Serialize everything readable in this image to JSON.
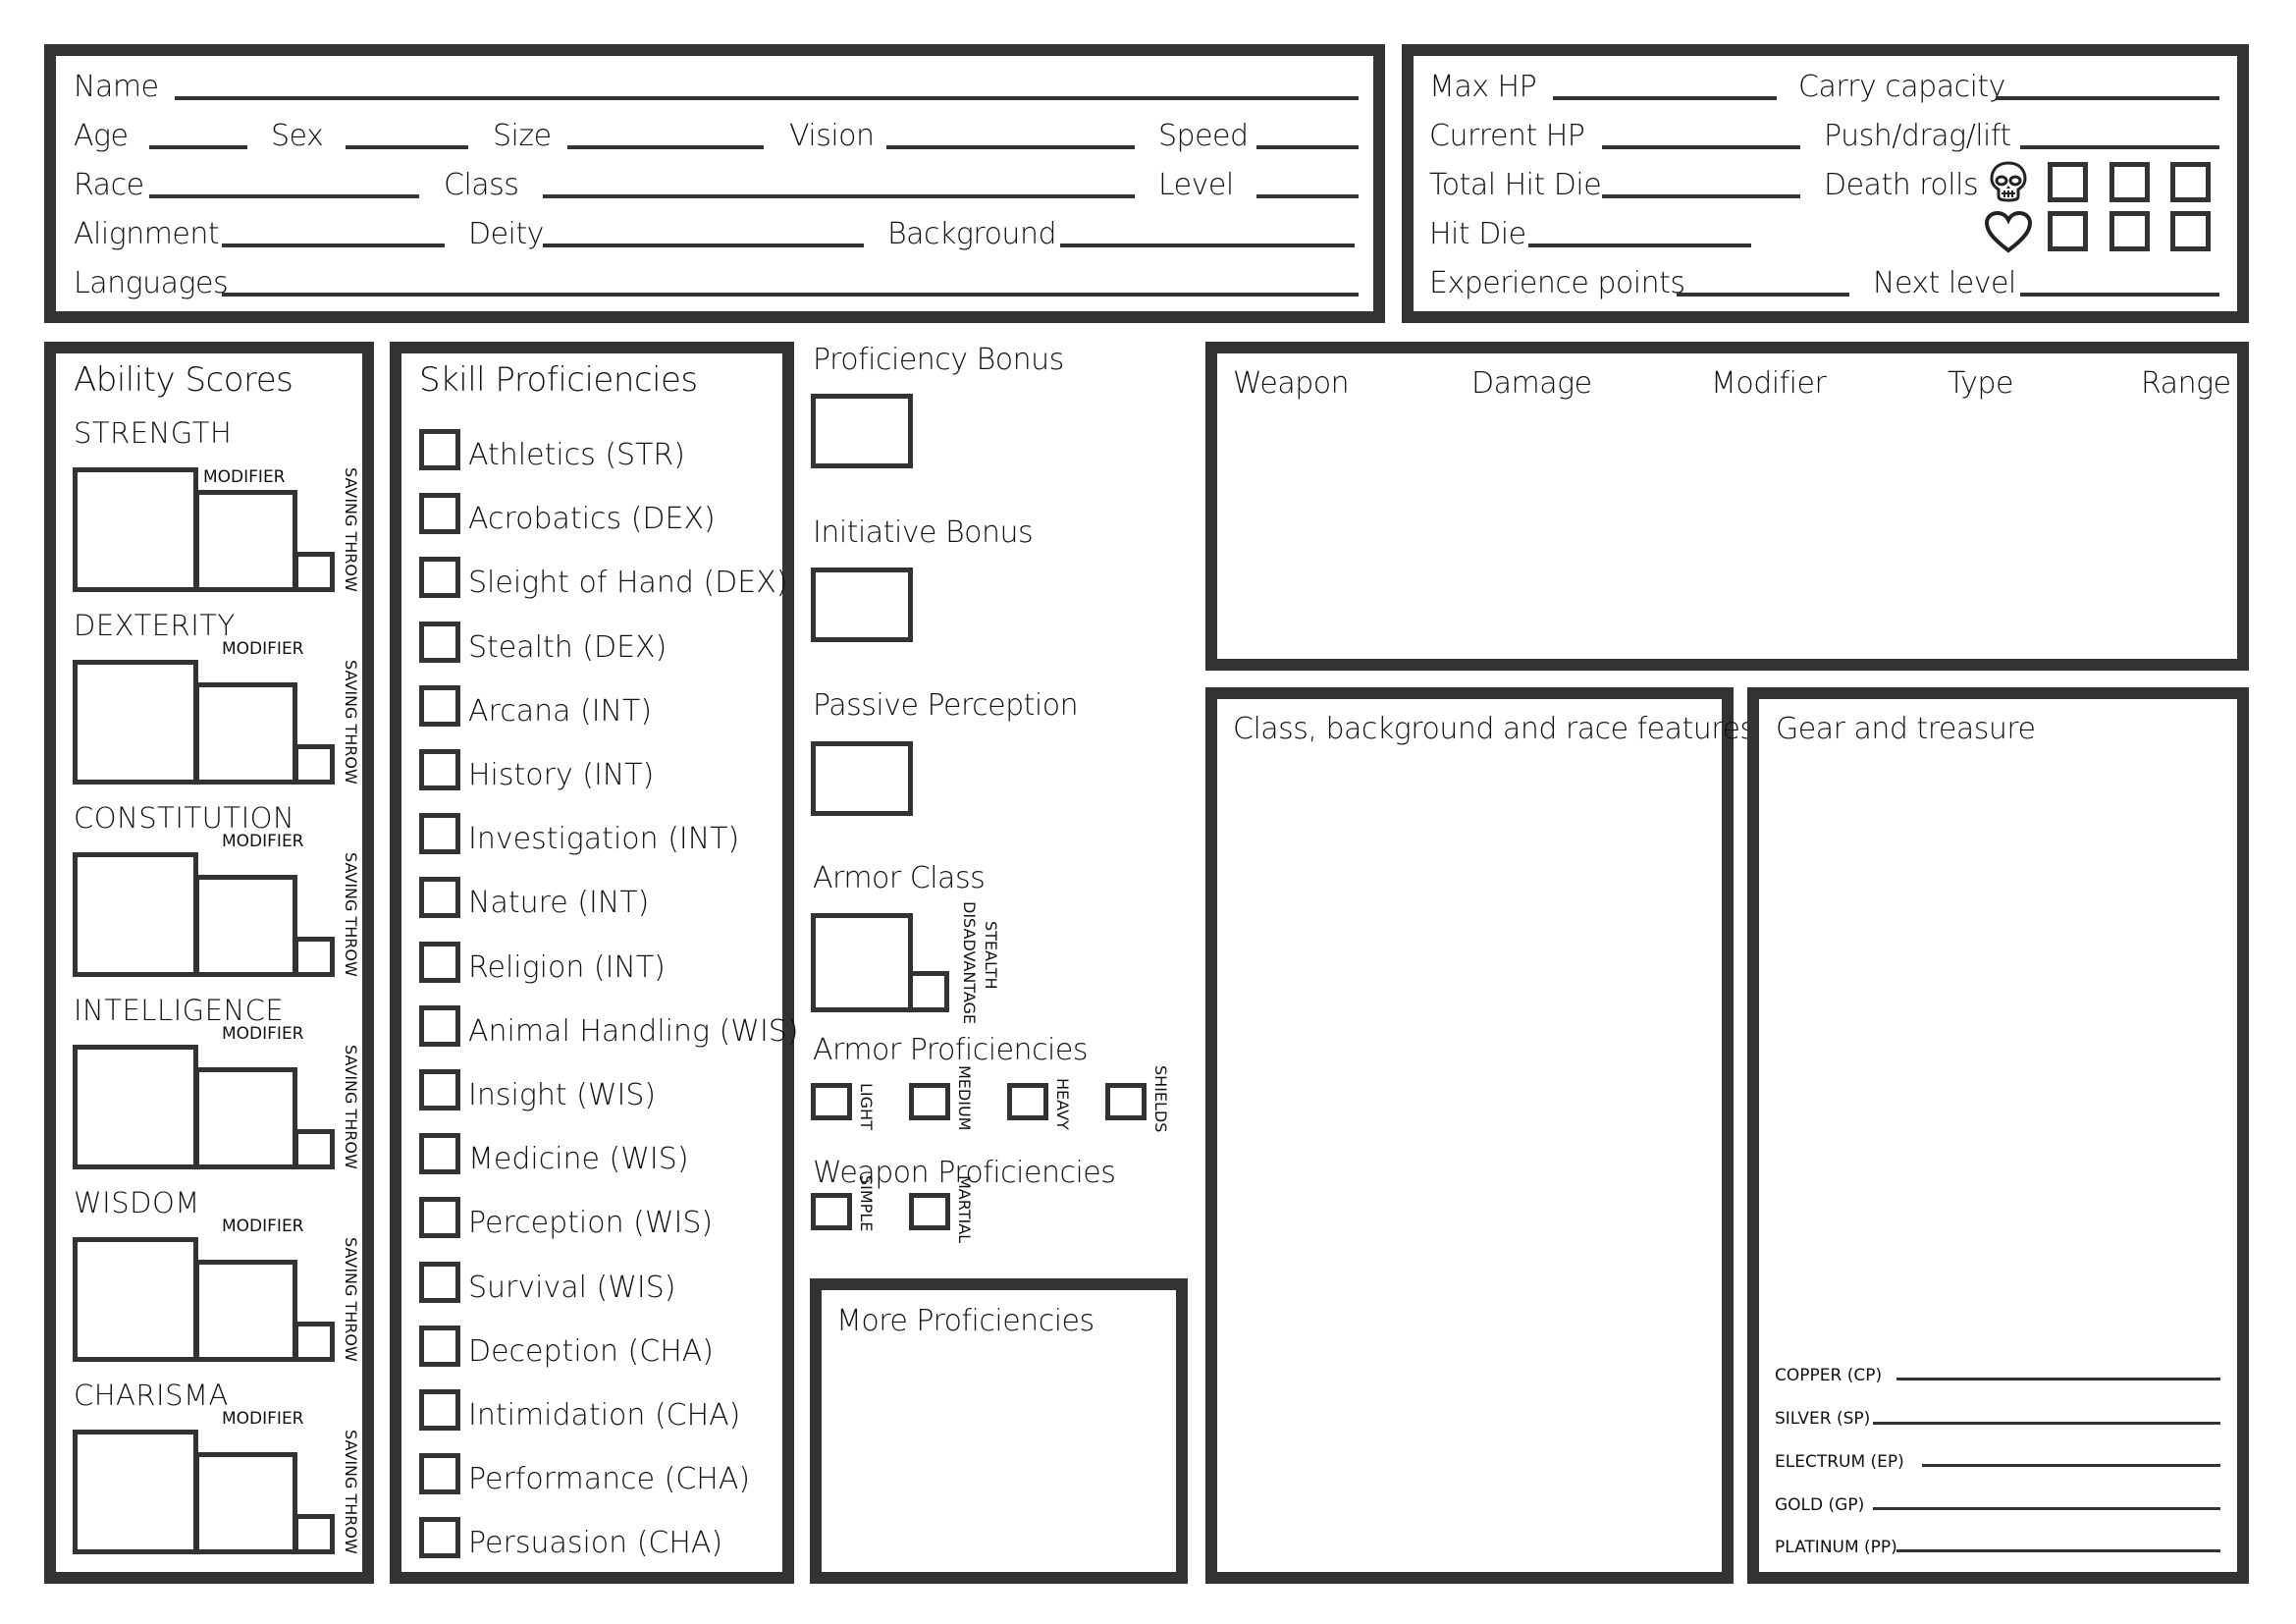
{
  "character": {
    "name_label": "Name",
    "age_label": "Age",
    "sex_label": "Sex",
    "size_label": "Size",
    "vision_label": "Vision",
    "speed_label": "Speed",
    "race_label": "Race",
    "class_label": "Class",
    "level_label": "Level",
    "alignment_label": "Alignment",
    "deity_label": "Deity",
    "background_label": "Background",
    "languages_label": "Languages"
  },
  "vitals": {
    "max_hp_label": "Max HP",
    "carry_capacity_label": "Carry capacity",
    "current_hp_label": "Current HP",
    "push_drag_lift_label": "Push/drag/lift",
    "total_hit_die_label": "Total Hit Die",
    "death_rolls_label": "Death rolls",
    "hit_die_label": "Hit Die",
    "experience_label": "Experience points",
    "next_level_label": "Next level",
    "death_fail_icon": "skull-icon",
    "death_success_icon": "heart-icon"
  },
  "abilities": {
    "title": "Ability Scores",
    "modifier_label": "MODIFIER",
    "saving_throw_label": "SAVING THROW",
    "items": [
      {
        "name": "STRENGTH"
      },
      {
        "name": "DEXTERITY"
      },
      {
        "name": "CONSTITUTION"
      },
      {
        "name": "INTELLIGENCE"
      },
      {
        "name": "WISDOM"
      },
      {
        "name": "CHARISMA"
      }
    ]
  },
  "skills": {
    "title": "Skill Proficiencies",
    "items": [
      "Athletics (STR)",
      "Acrobatics (DEX)",
      "Sleight of Hand (DEX)",
      "Stealth (DEX)",
      "Arcana (INT)",
      "History (INT)",
      "Investigation (INT)",
      "Nature (INT)",
      "Religion (INT)",
      "Animal Handling (WIS)",
      "Insight (WIS)",
      "Medicine (WIS)",
      "Perception (WIS)",
      "Survival (WIS)",
      "Deception (CHA)",
      "Intimidation (CHA)",
      "Performance (CHA)",
      "Persuasion (CHA)"
    ]
  },
  "combat": {
    "proficiency_bonus_label": "Proficiency Bonus",
    "initiative_bonus_label": "Initiative Bonus",
    "passive_perception_label": "Passive Perception",
    "armor_class_label": "Armor Class",
    "stealth_label": "STEALTH",
    "disadvantage_label": "DISADVANTAGE",
    "armor_prof_label": "Armor Proficiencies",
    "armor_types": [
      "LIGHT",
      "MEDIUM",
      "HEAVY",
      "SHIELDS"
    ],
    "weapon_prof_label": "Weapon Proficiencies",
    "weapon_types": [
      "SIMPLE",
      "MARTIAL"
    ],
    "more_prof_label": "More Proficiencies"
  },
  "weapons": {
    "columns": [
      "Weapon",
      "Damage",
      "Modifier",
      "Type",
      "Range"
    ]
  },
  "features": {
    "title": "Class, background and race features"
  },
  "gear": {
    "title": "Gear and treasure",
    "coins": [
      "COPPER (CP)",
      "SILVER (SP)",
      "ELECTRUM (EP)",
      "GOLD (GP)",
      "PLATINUM (PP)"
    ]
  },
  "colors": {
    "border": "#333333",
    "text": "#111111",
    "background": "#ffffff"
  }
}
